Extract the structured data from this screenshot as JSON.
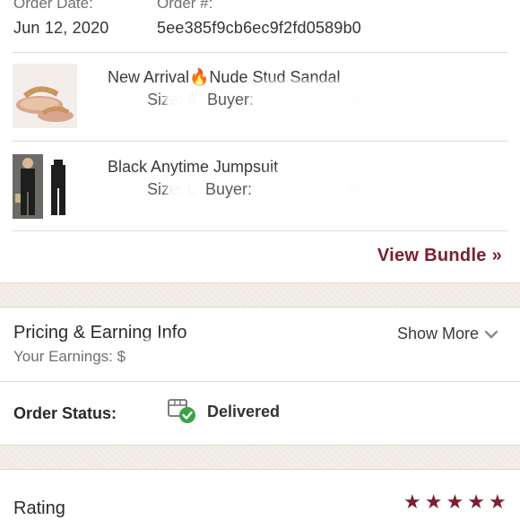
{
  "order": {
    "date_label": "Order Date:",
    "date_value": "Jun 12, 2020",
    "number_label": "Order #:",
    "number_value": "5ee385f9cb6ec9f2fd0589b0"
  },
  "items": [
    {
      "title": "New Arrival🔥Nude Stud Sandal",
      "size_text": "Size: 9",
      "buyer_text": "Buyer:",
      "price_fragment": "00"
    },
    {
      "title": "Black Anytime Jumpsuit",
      "size_text": "Size: L",
      "buyer_text": "Buyer:",
      "price_fragment": "00"
    }
  ],
  "bundle": {
    "link_label": "View Bundle »"
  },
  "pricing": {
    "title": "Pricing & Earning Info",
    "show_more_label": "Show More",
    "earnings_label": "Your Earnings: $"
  },
  "status": {
    "label": "Order Status:",
    "value": "Delivered",
    "icon": "delivered-box-check-icon"
  },
  "rating": {
    "title": "Rating",
    "stars": 5
  },
  "colors": {
    "accent": "#7a1f2e",
    "check_green": "#3aa34a",
    "band": "#efeae4"
  }
}
